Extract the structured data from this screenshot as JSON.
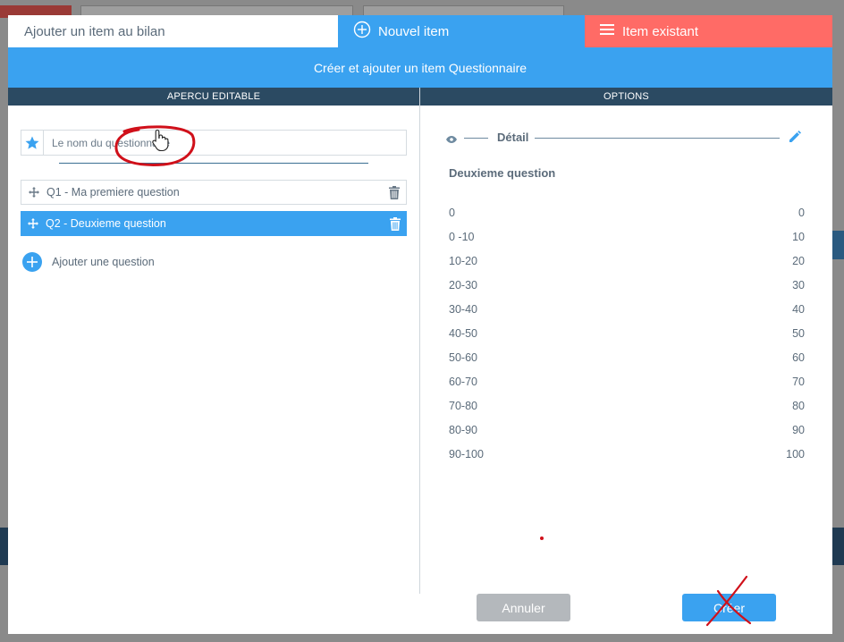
{
  "tabs": {
    "title": "Ajouter un item au bilan",
    "new_item": "Nouvel item",
    "existing_item": "Item existant"
  },
  "banner": "Créer et ajouter un item Questionnaire",
  "sections": {
    "left": "APERCU EDITABLE",
    "right": "OPTIONS"
  },
  "editor": {
    "name_placeholder": "Le nom du questionnaire",
    "questions": [
      {
        "label": "Q1 - Ma premiere question",
        "selected": false
      },
      {
        "label": "Q2 - Deuxieme question",
        "selected": true
      }
    ],
    "add_question": "Ajouter une question"
  },
  "options": {
    "detail_label": "Détail",
    "question_title": "Deuxieme question",
    "rows": [
      {
        "label": "0",
        "value": "0"
      },
      {
        "label": "0 -10",
        "value": "10"
      },
      {
        "label": "10-20",
        "value": "20"
      },
      {
        "label": "20-30",
        "value": "30"
      },
      {
        "label": "30-40",
        "value": "40"
      },
      {
        "label": "40-50",
        "value": "50"
      },
      {
        "label": "50-60",
        "value": "60"
      },
      {
        "label": "60-70",
        "value": "70"
      },
      {
        "label": "70-80",
        "value": "80"
      },
      {
        "label": "80-90",
        "value": "90"
      },
      {
        "label": "90-100",
        "value": "100"
      }
    ]
  },
  "buttons": {
    "cancel": "Annuler",
    "create": "Créer"
  },
  "colors": {
    "accent_blue": "#3aa2f0",
    "accent_red": "#ff6b66",
    "header_dark": "#2b4a62",
    "annotation_red": "#d0101a"
  }
}
